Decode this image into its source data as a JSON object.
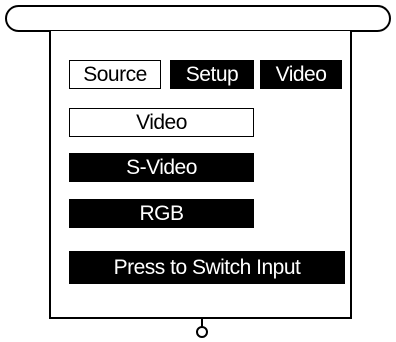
{
  "tabs": {
    "source_label": "Source",
    "setup_label": "Setup",
    "video_label": "Video"
  },
  "inputs": {
    "video_label": "Video",
    "svideo_label": "S-Video",
    "rgb_label": "RGB",
    "selected": "Video"
  },
  "actions": {
    "switch_label": "Press to Switch Input"
  },
  "colors": {
    "ink": "#000000",
    "paper": "#ffffff"
  }
}
